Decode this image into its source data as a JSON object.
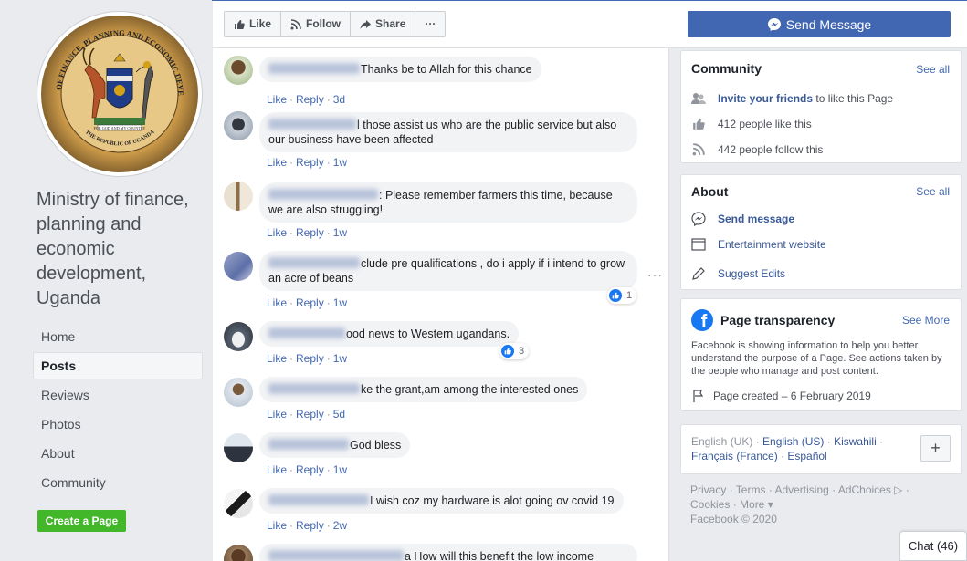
{
  "sidebar": {
    "page_name": "Ministry of finance, planning and economic development, Uganda",
    "nav": [
      "Home",
      "Posts",
      "Reviews",
      "Photos",
      "About",
      "Community"
    ],
    "active_nav": "Posts",
    "create_page": "Create a Page",
    "seal": {
      "top_text": "OF FINANCE, PLANNING AND ECONOMIC DEVELOPMENT",
      "motto": "FOR GOD AND MY COUNTRY",
      "bottom_text": "THE REPUBLIC OF UGANDA"
    }
  },
  "actionbar": {
    "like": "Like",
    "follow": "Follow",
    "share": "Share",
    "more": "···",
    "send_message": "Send Message"
  },
  "comments": [
    {
      "text": "Thanks be to Allah for this chance",
      "time": "3d"
    },
    {
      "text": "l those assist us who are the public service but also our business have been affected",
      "time": "1w"
    },
    {
      "text": ": Please remember farmers this time, because we are also struggling!",
      "time": "1w"
    },
    {
      "text": "clude pre qualifications , do i apply if i intend to grow an acre of beans",
      "time": "1w",
      "reactions": "1"
    },
    {
      "text": "ood news to Western ugandans.",
      "time": "1w",
      "reactions": "3"
    },
    {
      "text": "ke the grant,am among the interested ones",
      "time": "5d"
    },
    {
      "text": "God bless",
      "time": "1w"
    },
    {
      "text": "I wish coz my hardware is alot going ov covid 19",
      "time": "2w"
    },
    {
      "text": "a How will this benefit the low income"
    }
  ],
  "comment_actions": {
    "like": "Like",
    "reply": "Reply",
    "sep": "·"
  },
  "community": {
    "title": "Community",
    "see_all": "See all",
    "invite_link": "Invite your friends",
    "invite_rest": "to like this Page",
    "likes": "412 people like this",
    "follows": "442 people follow this"
  },
  "about": {
    "title": "About",
    "see_all": "See all",
    "send_message": "Send message",
    "website": "Entertainment website",
    "suggest": "Suggest Edits"
  },
  "transparency": {
    "title": "Page transparency",
    "see_more": "See More",
    "desc": "Facebook is showing information to help you better understand the purpose of a Page. See actions taken by the people who manage and post content.",
    "created": "Page created – 6 February 2019"
  },
  "languages": {
    "current": "English (UK)",
    "sep": " · ",
    "others": [
      "English (US)",
      "Kiswahili",
      "Français (France)",
      "Español"
    ]
  },
  "footer": {
    "line1": "Privacy · Terms · Advertising · AdChoices ▷ ·",
    "line2": "Cookies · More ▾",
    "copyright": "Facebook © 2020"
  },
  "chat": {
    "label": "Chat (46)"
  },
  "colors": {
    "brand": "#4267b2",
    "link": "#385898",
    "green": "#42b72a",
    "bg": "#e9ebee"
  }
}
